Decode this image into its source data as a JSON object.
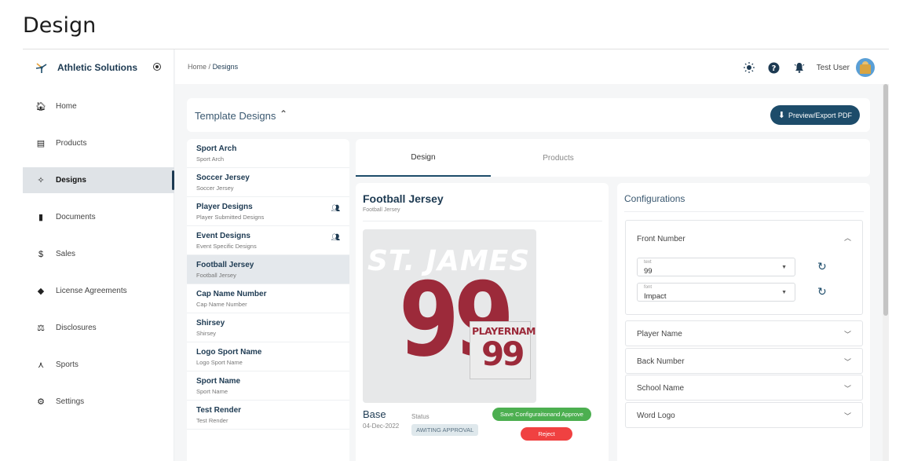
{
  "page": {
    "title": "Design"
  },
  "brand": {
    "name": "Athletic Solutions"
  },
  "sidebar": {
    "items": [
      {
        "label": "Home",
        "icon": "home-icon",
        "glyph": "🏠︎"
      },
      {
        "label": "Products",
        "icon": "archive-icon",
        "glyph": "▤"
      },
      {
        "label": "Designs",
        "icon": "magic-wand-icon",
        "glyph": "✧"
      },
      {
        "label": "Documents",
        "icon": "document-icon",
        "glyph": "▮"
      },
      {
        "label": "Sales",
        "icon": "dollar-icon",
        "glyph": "$"
      },
      {
        "label": "License Agreements",
        "icon": "handshake-icon",
        "glyph": "◆"
      },
      {
        "label": "Disclosures",
        "icon": "scale-icon",
        "glyph": "⚖"
      },
      {
        "label": "Sports",
        "icon": "network-icon",
        "glyph": "⋏"
      },
      {
        "label": "Settings",
        "icon": "gear-icon",
        "glyph": "⚙"
      }
    ],
    "active_index": 2
  },
  "header": {
    "breadcrumb_home": "Home",
    "breadcrumb_sep": "/",
    "breadcrumb_current": "Designs",
    "user_name": "Test User"
  },
  "templates": {
    "title": "Template Designs",
    "export_label": "Preview/Export PDF",
    "items": [
      {
        "name": "Sport Arch",
        "sub": "Sport Arch"
      },
      {
        "name": "Soccer Jersey",
        "sub": "Soccer Jersey"
      },
      {
        "name": "Player Designs",
        "sub": "Player Submitted Designs"
      },
      {
        "name": "Event Designs",
        "sub": "Event Specific Designs"
      },
      {
        "name": "Football Jersey",
        "sub": "Football Jersey"
      },
      {
        "name": "Cap Name Number",
        "sub": "Cap Name Number"
      },
      {
        "name": "Shirsey",
        "sub": "Shirsey"
      },
      {
        "name": "Logo Sport Name",
        "sub": "Logo Sport Name"
      },
      {
        "name": "Sport Name",
        "sub": "Sport Name"
      },
      {
        "name": "Test Render",
        "sub": "Test Render"
      }
    ]
  },
  "tabs": {
    "design": "Design",
    "products": "Products"
  },
  "design": {
    "title": "Football Jersey",
    "subtitle": "Football Jersey",
    "preview_school": "ST. JAMES",
    "preview_number": "99",
    "preview_player_name": "PLAYERNAME",
    "preview_player_number": "99",
    "base_label": "Base",
    "date": "04-Dec-2022",
    "status_label": "Status",
    "status_value": "AWITING APPROVAL",
    "save_label": "Save Configuraitonand Approve",
    "reject_label": "Reject"
  },
  "config": {
    "title": "Configurations",
    "front_number": {
      "title": "Front Number",
      "text_label": "text",
      "text_value": "99",
      "font_label": "font",
      "font_value": "Impact"
    },
    "sections": [
      "Player Name",
      "Back Number",
      "School Name",
      "Word Logo"
    ]
  },
  "colors": {
    "primary": "#1d4c6a",
    "approve": "#4caf50",
    "reject": "#f04141",
    "jersey": "#9c2a3a"
  }
}
